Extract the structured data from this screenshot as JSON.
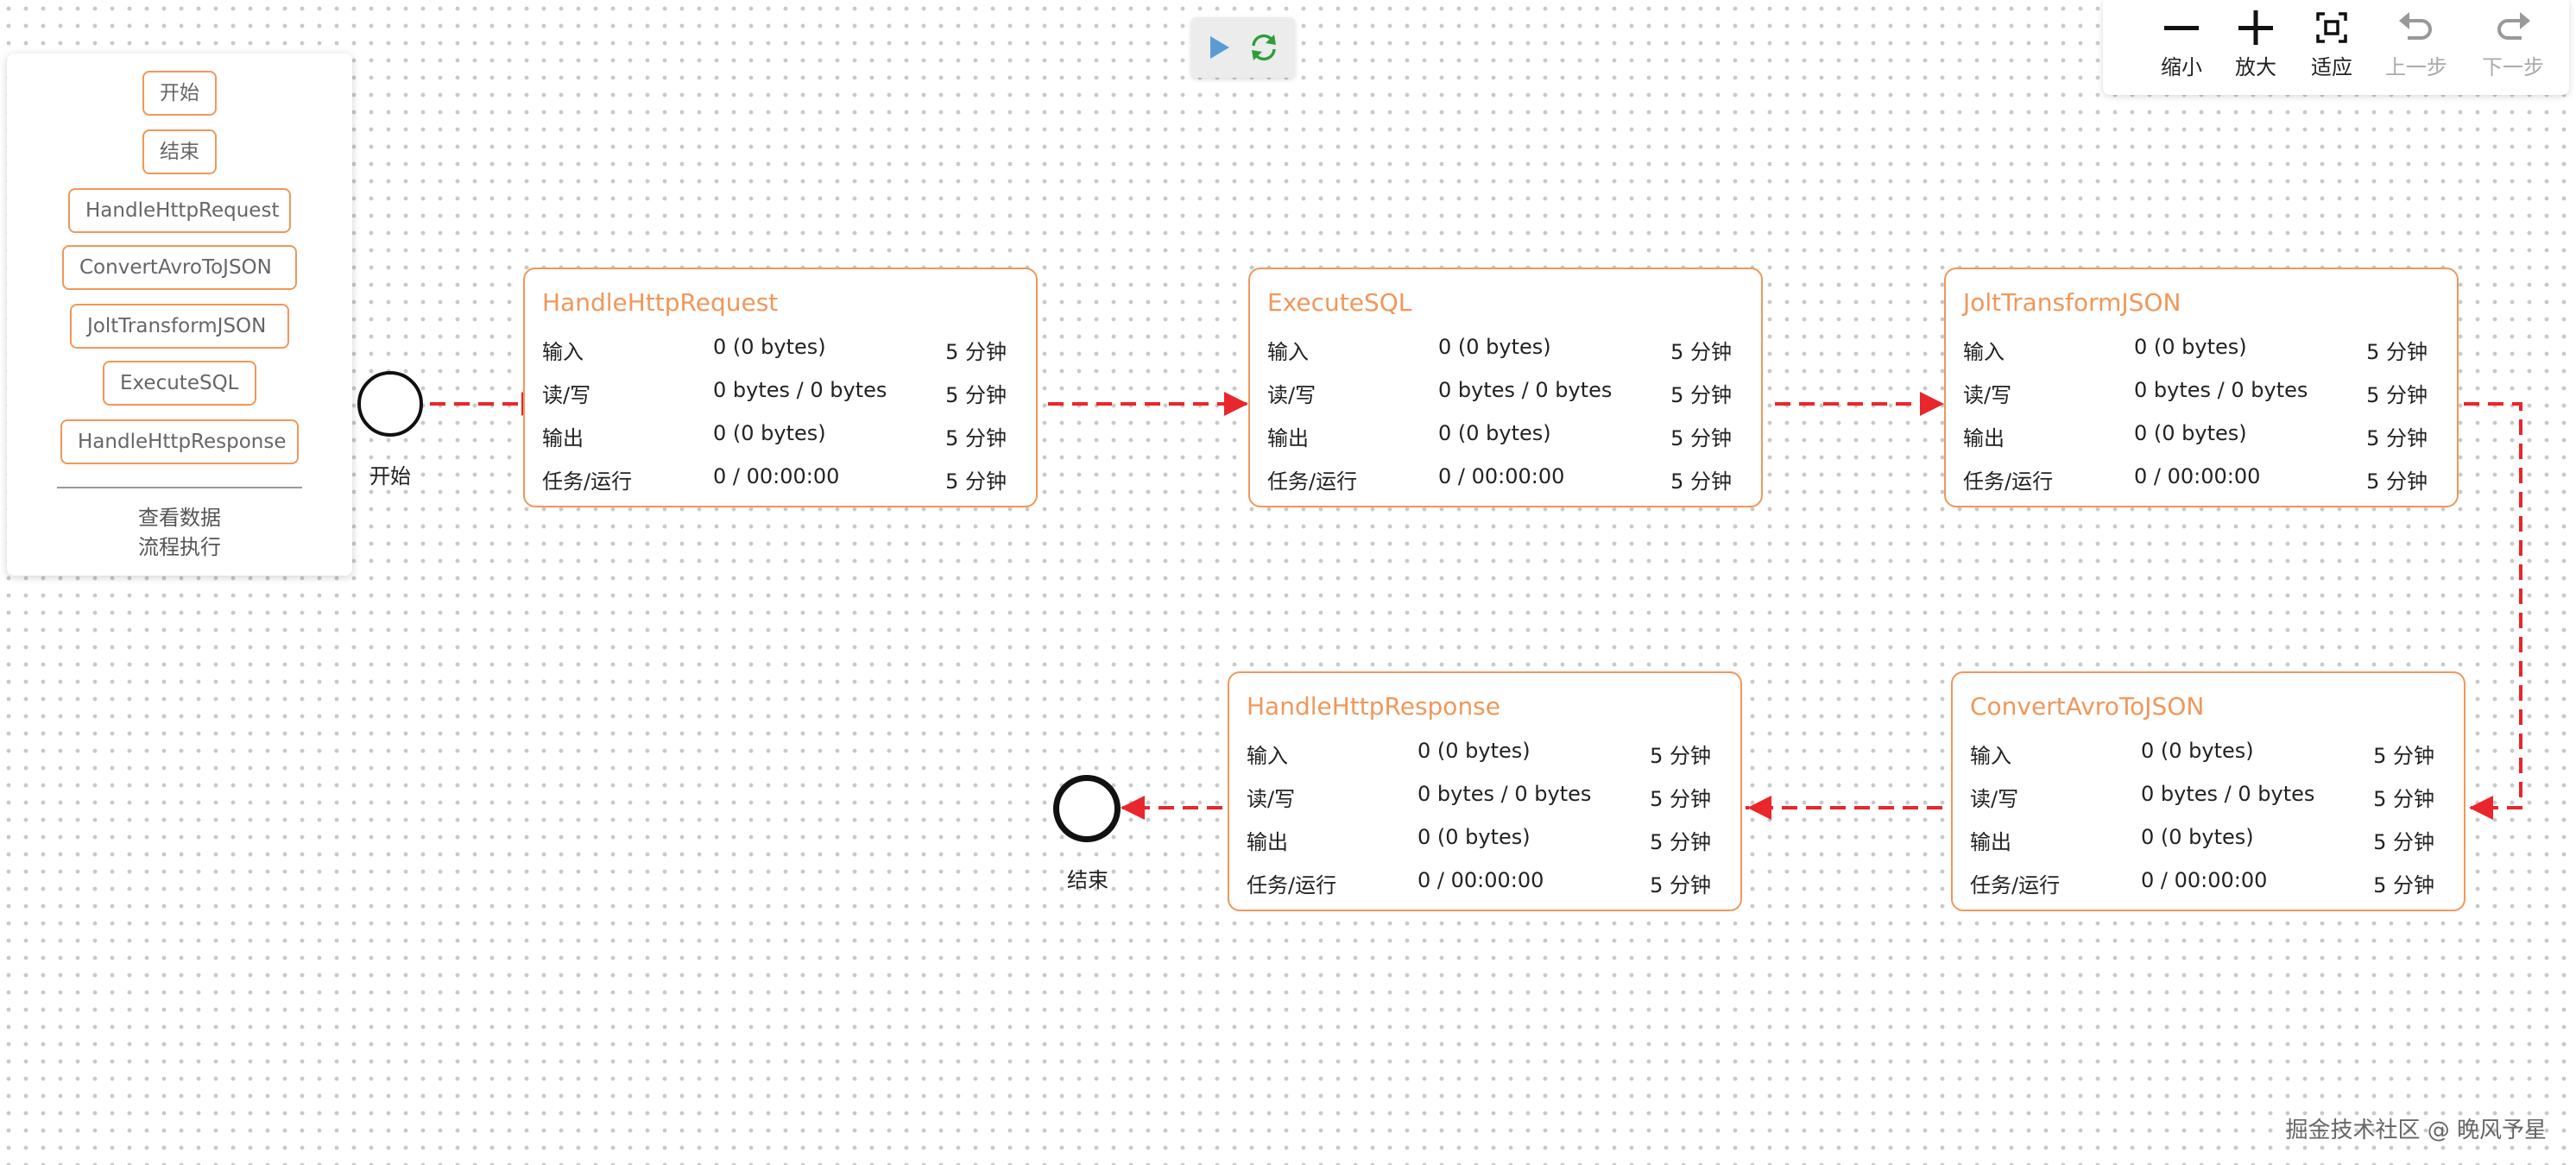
{
  "palette": {
    "items": [
      "开始",
      "结束",
      "HandleHttpRequest",
      "ConvertAvroToJSON",
      "JoltTransformJSON",
      "ExecuteSQL",
      "HandleHttpResponse"
    ],
    "links": [
      "查看数据",
      "流程执行"
    ]
  },
  "runbar": {
    "play_icon": "play-icon",
    "refresh_icon": "refresh-icon"
  },
  "toolbar": {
    "zoom_out": "缩小",
    "zoom_in": "放大",
    "fit": "适应",
    "undo": "上一步",
    "redo": "下一步"
  },
  "start": {
    "label": "开始"
  },
  "end": {
    "label": "结束"
  },
  "row_labels": [
    "输入",
    "读/写",
    "输出",
    "任务/运行"
  ],
  "nodes": [
    {
      "title": "HandleHttpRequest",
      "rows": [
        [
          "输入",
          "0 (0 bytes)",
          "5 分钟"
        ],
        [
          "读/写",
          "0 bytes / 0 bytes",
          "5 分钟"
        ],
        [
          "输出",
          "0 (0 bytes)",
          "5 分钟"
        ],
        [
          "任务/运行",
          "0 / 00:00:00",
          "5 分钟"
        ]
      ]
    },
    {
      "title": "ExecuteSQL",
      "rows": [
        [
          "输入",
          "0 (0 bytes)",
          "5 分钟"
        ],
        [
          "读/写",
          "0 bytes / 0 bytes",
          "5 分钟"
        ],
        [
          "输出",
          "0 (0 bytes)",
          "5 分钟"
        ],
        [
          "任务/运行",
          "0 / 00:00:00",
          "5 分钟"
        ]
      ]
    },
    {
      "title": "JoltTransformJSON",
      "rows": [
        [
          "输入",
          "0 (0 bytes)",
          "5 分钟"
        ],
        [
          "读/写",
          "0 bytes / 0 bytes",
          "5 分钟"
        ],
        [
          "输出",
          "0 (0 bytes)",
          "5 分钟"
        ],
        [
          "任务/运行",
          "0 / 00:00:00",
          "5 分钟"
        ]
      ]
    },
    {
      "title": "HandleHttpResponse",
      "rows": [
        [
          "输入",
          "0 (0 bytes)",
          "5 分钟"
        ],
        [
          "读/写",
          "0 bytes / 0 bytes",
          "5 分钟"
        ],
        [
          "输出",
          "0 (0 bytes)",
          "5 分钟"
        ],
        [
          "任务/运行",
          "0 / 00:00:00",
          "5 分钟"
        ]
      ]
    },
    {
      "title": "ConvertAvroToJSON",
      "rows": [
        [
          "输入",
          "0 (0 bytes)",
          "5 分钟"
        ],
        [
          "读/写",
          "0 bytes / 0 bytes",
          "5 分钟"
        ],
        [
          "输出",
          "0 (0 bytes)",
          "5 分钟"
        ],
        [
          "任务/运行",
          "0 / 00:00:00",
          "5 分钟"
        ]
      ]
    }
  ],
  "colors": {
    "accent": "#f0975a",
    "edge": "#e8262c",
    "play": "#5b9bd5",
    "refresh": "#2e9d3a"
  },
  "watermark": "掘金技术社区 @ 晚风予星"
}
